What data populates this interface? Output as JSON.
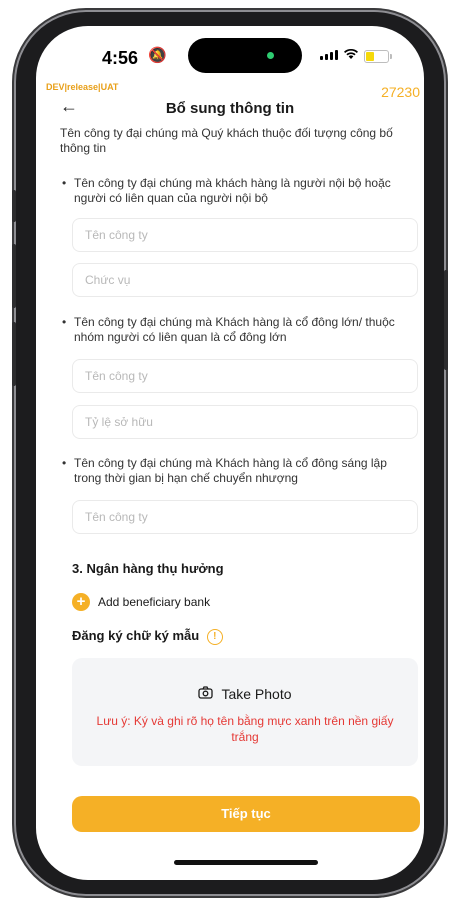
{
  "status": {
    "time": "4:56"
  },
  "env": {
    "label": "DEV|release|UAT",
    "build": "27230"
  },
  "navbar": {
    "title": "Bổ sung thông tin"
  },
  "intro": "Tên công ty đại chúng mà Quý khách thuộc đối tượng công bố thông tin",
  "groups": [
    {
      "label": "Tên công ty đại chúng mà khách hàng là người nội bộ hoặc người có liên quan của người nội bộ",
      "fields": [
        {
          "placeholder": "Tên công ty"
        },
        {
          "placeholder": "Chức vụ"
        }
      ]
    },
    {
      "label": "Tên công ty đại chúng mà Khách hàng là cổ đông lớn/ thuộc nhóm người có liên quan là cổ đông lớn",
      "fields": [
        {
          "placeholder": "Tên công ty"
        },
        {
          "placeholder": "Tỷ lệ sở hữu"
        }
      ]
    },
    {
      "label": "Tên công ty đại chúng mà Khách hàng là cổ đông sáng lập trong thời gian bị hạn chế chuyển nhượng",
      "fields": [
        {
          "placeholder": "Tên công ty"
        }
      ]
    }
  ],
  "bank": {
    "title": "3. Ngân hàng thụ hưởng",
    "add_label": "Add beneficiary bank"
  },
  "signature": {
    "title": "Đăng ký chữ ký mẫu",
    "take_photo": "Take Photo",
    "note": "Lưu ý: Ký và ghi rõ họ tên bằng mực xanh trên nền giấy trắng"
  },
  "cta": {
    "label": "Tiếp tục"
  },
  "colors": {
    "accent": "#f5b026",
    "warning_text": "#e53935"
  }
}
